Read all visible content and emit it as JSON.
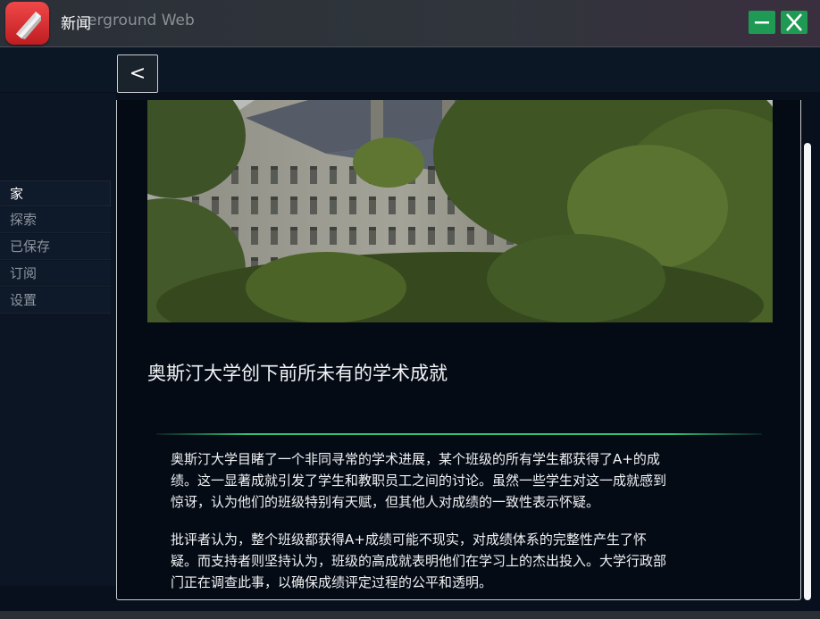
{
  "window": {
    "title": "新闻",
    "app_name_ghost": "erground Web",
    "logo_icon": "app-logo-icon",
    "minimize_icon": "minimize-icon",
    "close_icon": "close-icon"
  },
  "toolbar": {
    "back_label": "<"
  },
  "sidebar": {
    "items": [
      {
        "label": "家",
        "active": true
      },
      {
        "label": "探索",
        "active": false
      },
      {
        "label": "已保存",
        "active": false
      },
      {
        "label": "订阅",
        "active": false
      },
      {
        "label": "设置",
        "active": false
      }
    ]
  },
  "article": {
    "title": "奥斯汀大学创下前所未有的学术成就",
    "paragraphs": [
      "奥斯汀大学目睹了一个非同寻常的学术进展，某个班级的所有学生都获得了A+的成\n绩。这一显著成就引发了学生和教职员工之间的讨论。虽然一些学生对这一成就感到\n惊讶，认为他们的班级特别有天赋，但其他人对成绩的一致性表示怀疑。",
      "批评者认为，整个班级都获得A+成绩可能不现实，对成绩体系的完整性产生了怀\n疑。而支持者则坚持认为，班级的高成就表明他们在学习上的杰出投入。大学行政部\n门正在调查此事，以确保成绩评定过程的公平和透明。"
    ]
  },
  "colors": {
    "accent": "#1f9a55",
    "divider": "#33c07a",
    "brand": "#e03a3e"
  }
}
